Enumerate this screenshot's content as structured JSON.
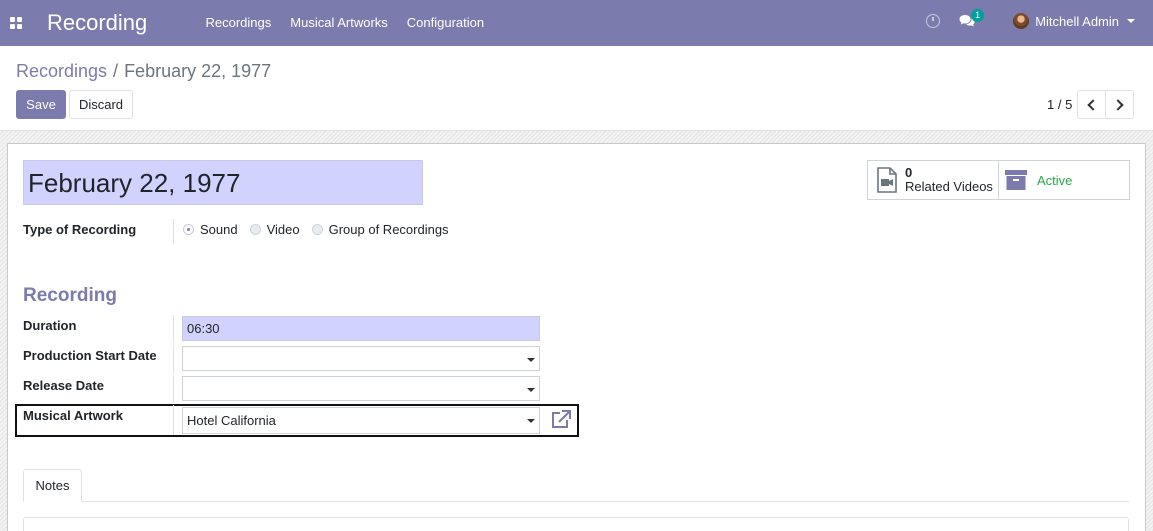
{
  "app": {
    "title": "Recording",
    "menu": [
      "Recordings",
      "Musical Artworks",
      "Configuration"
    ],
    "user": "Mitchell Admin",
    "chat_count": "1"
  },
  "breadcrumb": {
    "parent": "Recordings",
    "separator": "/",
    "current": "February 22, 1977"
  },
  "buttons": {
    "save": "Save",
    "discard": "Discard"
  },
  "pager": {
    "value": "1 / 5"
  },
  "record": {
    "name": "February 22, 1977",
    "smart_buttons": {
      "videos_count": "0",
      "videos_label": "Related Videos",
      "active_label": "Active"
    },
    "type_label": "Type of Recording",
    "type_options": [
      "Sound",
      "Video",
      "Group of Recordings"
    ],
    "type_selected": "Sound",
    "section_title": "Recording",
    "fields": {
      "duration_label": "Duration",
      "duration_value": "06:30",
      "production_start_label": "Production Start Date",
      "production_start_value": "",
      "release_label": "Release Date",
      "release_value": "",
      "artwork_label": "Musical Artwork",
      "artwork_value": "Hotel California"
    },
    "tabs": [
      "Notes"
    ]
  },
  "colors": {
    "primary": "#7c7bad",
    "required_field": "#d2d2ff",
    "active_green": "#28a745",
    "badge": "#00a09d"
  }
}
